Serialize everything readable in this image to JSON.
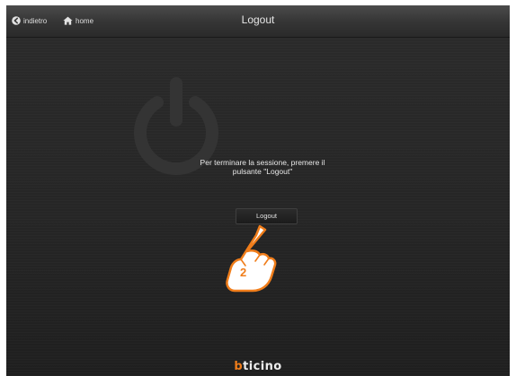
{
  "header": {
    "back_label": "indietro",
    "home_label": "home",
    "title": "Logout"
  },
  "main": {
    "message_line1": "Per terminare la sessione, premere il",
    "message_line2": "pulsante \"Logout\"",
    "logout_button_label": "Logout"
  },
  "annotation": {
    "step_number": "2"
  },
  "footer": {
    "brand_first": "b",
    "brand_rest": "ticino"
  },
  "colors": {
    "accent": "#f07d1a",
    "background": "#262626",
    "text": "#e8e8e8"
  },
  "icons": {
    "back": "back-arrow-circle-icon",
    "home": "home-icon",
    "power": "power-icon",
    "hand": "pointing-hand-icon"
  }
}
